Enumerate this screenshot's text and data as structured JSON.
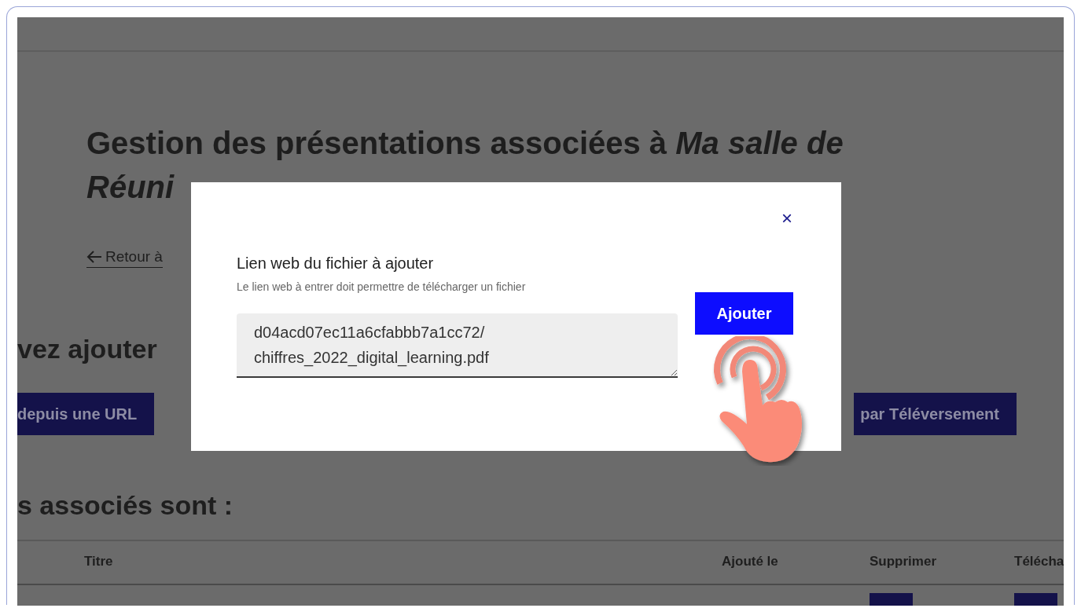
{
  "page": {
    "title": "Gestion des présentations associées à *Ma salle de* *Réuni*",
    "back_link": "Retour à",
    "add_heading": "vez ajouter",
    "buttons": [
      {
        "label": "depuis une URL"
      },
      {
        "label": "par Téléversement"
      }
    ],
    "list_heading": "s associés sont :"
  },
  "table": {
    "columns": [
      "Titre",
      "Ajouté le",
      "Supprimer",
      "Télécha"
    ]
  },
  "modal": {
    "close": "×",
    "label": "Lien web du fichier à ajouter",
    "hint": "Le lien web à entrer doit permettre de télécharger un fichier",
    "value": "d04acd07ec11a6cfabbb7a1cc72/\nchiffres_2022_digital_learning.pdf",
    "submit": "Ajouter"
  }
}
